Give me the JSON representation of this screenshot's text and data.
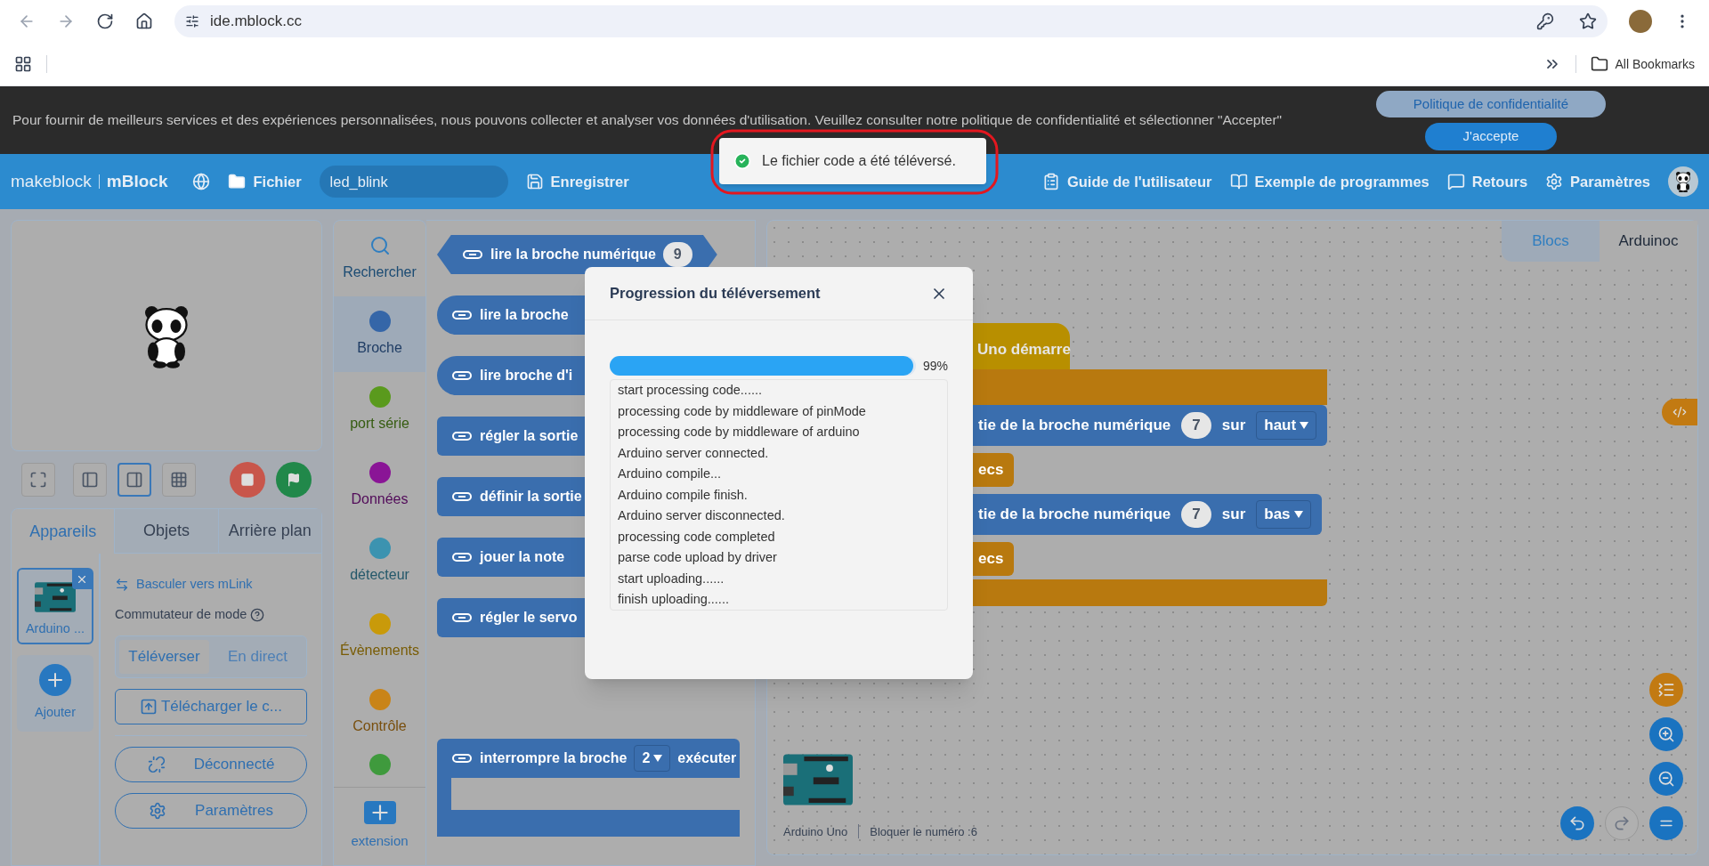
{
  "browser": {
    "url": "ide.mblock.cc",
    "bookmarks_label": "All Bookmarks"
  },
  "banner": {
    "text": "Pour fournir de meilleurs services et des expériences personnalisées, nous pouvons collecter et analyser vos données d'utilisation. Veuillez consulter notre politique de confidentialité et sélectionner \"Accepter\"",
    "buttons": [
      {
        "label": "Politique de confidentialité",
        "kind": "secondary"
      },
      {
        "label": "J'accepte",
        "kind": "primary"
      }
    ]
  },
  "toast": {
    "message": "Le fichier code a été téléversé."
  },
  "header": {
    "brand": "makeblock",
    "product": "mBlock",
    "file_menu": "Fichier",
    "project_name": "led_blink",
    "save": "Enregistrer",
    "menu": [
      {
        "label": "Guide de l'utilisateur",
        "kind": "guide"
      },
      {
        "label": "Exemple de programmes",
        "kind": "examples"
      },
      {
        "label": "Retours",
        "kind": "feedback"
      },
      {
        "label": "Paramètres",
        "kind": "settings"
      }
    ]
  },
  "stage": {
    "view_buttons": [
      {
        "kind": "fullscreen",
        "selected": false
      },
      {
        "kind": "small",
        "selected": false
      },
      {
        "kind": "large",
        "selected": true
      },
      {
        "kind": "grid",
        "selected": false
      }
    ]
  },
  "tabs": [
    {
      "label": "Appareils",
      "selected": true
    },
    {
      "label": "Objets",
      "selected": false
    },
    {
      "label": "Arrière plan",
      "selected": false
    }
  ],
  "devices": {
    "items": [
      {
        "name": "Arduino ...",
        "selected": true
      }
    ],
    "add_label": "Ajouter"
  },
  "device_panel": {
    "switch_link": "Basculer vers mLink",
    "mode_label": "Commutateur de mode",
    "modes": [
      {
        "label": "Téléverser",
        "selected": true
      },
      {
        "label": "En direct",
        "selected": false
      }
    ],
    "upload_button": "Télécharger le c...",
    "connect_button": "Déconnecté",
    "settings_button": "Paramètres"
  },
  "categories": [
    {
      "kind": "search",
      "label": "Rechercher",
      "selected": false
    },
    {
      "kind": "dot",
      "label": "Broche",
      "color": "#3566a8",
      "selected": true
    },
    {
      "kind": "dot",
      "label": "port série",
      "color": "#5a9a1d",
      "selected": false
    },
    {
      "kind": "dot",
      "label": "Données",
      "color": "#8a1596",
      "selected": false
    },
    {
      "kind": "dot",
      "label": "détecteur",
      "color": "#3c93b0",
      "selected": false
    },
    {
      "kind": "dot",
      "label": "Évènements",
      "color": "#c99a0a",
      "selected": false
    },
    {
      "kind": "dot",
      "label": "Contrôle",
      "color": "#c98418",
      "selected": false
    },
    {
      "kind": "dot",
      "color": "#3f9a3d",
      "selected": false
    }
  ],
  "extension": {
    "label": "extension"
  },
  "palette": [
    {
      "kind": "boolean",
      "parts": [
        {
          "kind": "text",
          "text": "lire la broche numérique"
        },
        {
          "kind": "number",
          "text": "9"
        }
      ]
    },
    {
      "kind": "reporter",
      "parts": [
        {
          "kind": "text",
          "text": "lire la broche"
        }
      ]
    },
    {
      "kind": "reporter",
      "parts": [
        {
          "kind": "text",
          "text": "lire broche d'i"
        }
      ]
    },
    {
      "kind": "command",
      "parts": [
        {
          "kind": "text",
          "text": "régler la sortie"
        }
      ]
    },
    {
      "kind": "command",
      "parts": [
        {
          "kind": "text",
          "text": "définir la sortie"
        }
      ]
    },
    {
      "kind": "command",
      "parts": [
        {
          "kind": "text",
          "text": "jouer la note"
        }
      ]
    },
    {
      "kind": "command",
      "parts": [
        {
          "kind": "text",
          "text": "régler le servo"
        }
      ]
    },
    {
      "kind": "c_block",
      "parts": [
        {
          "kind": "text",
          "text": "interrompre la broche"
        },
        {
          "kind": "dropdown",
          "text": "2"
        },
        {
          "kind": "text",
          "text": "exécuter"
        }
      ]
    }
  ],
  "dialog": {
    "title": "Progression du téléversement",
    "progress": {
      "level": 0.99,
      "reading": "99%"
    },
    "log": [
      "start processing code......",
      "processing code by middleware of pinMode",
      "processing code by middleware of arduino",
      "Arduino server connected.",
      "Arduino compile...",
      "Arduino compile finish.",
      "Arduino server disconnected.",
      "processing code completed",
      "parse code upload by driver",
      "start uploading......",
      "finish uploading......"
    ]
  },
  "canvas": {
    "tabs": [
      {
        "label": "Blocs",
        "selected": true
      },
      {
        "label": "Arduinoc",
        "selected": false
      }
    ],
    "script": {
      "hat": "Uno démarre",
      "blocks": [
        {
          "kind": "pin",
          "parts": [
            {
              "kind": "text",
              "text": "tie de la broche numérique"
            },
            {
              "kind": "number",
              "text": "7"
            },
            {
              "kind": "text",
              "text": "sur"
            },
            {
              "kind": "dropdown",
              "text": "haut"
            }
          ]
        },
        {
          "kind": "control",
          "parts": [
            {
              "kind": "text",
              "text": "ecs"
            }
          ]
        },
        {
          "kind": "pin",
          "parts": [
            {
              "kind": "text",
              "text": "tie de la broche numérique"
            },
            {
              "kind": "number",
              "text": "7"
            },
            {
              "kind": "text",
              "text": "sur"
            },
            {
              "kind": "dropdown",
              "text": "bas"
            }
          ]
        },
        {
          "kind": "control",
          "parts": [
            {
              "kind": "text",
              "text": "ecs"
            }
          ]
        }
      ]
    },
    "footer": {
      "device": "Arduino Uno",
      "block_count": "Bloquer le numéro :6"
    }
  }
}
